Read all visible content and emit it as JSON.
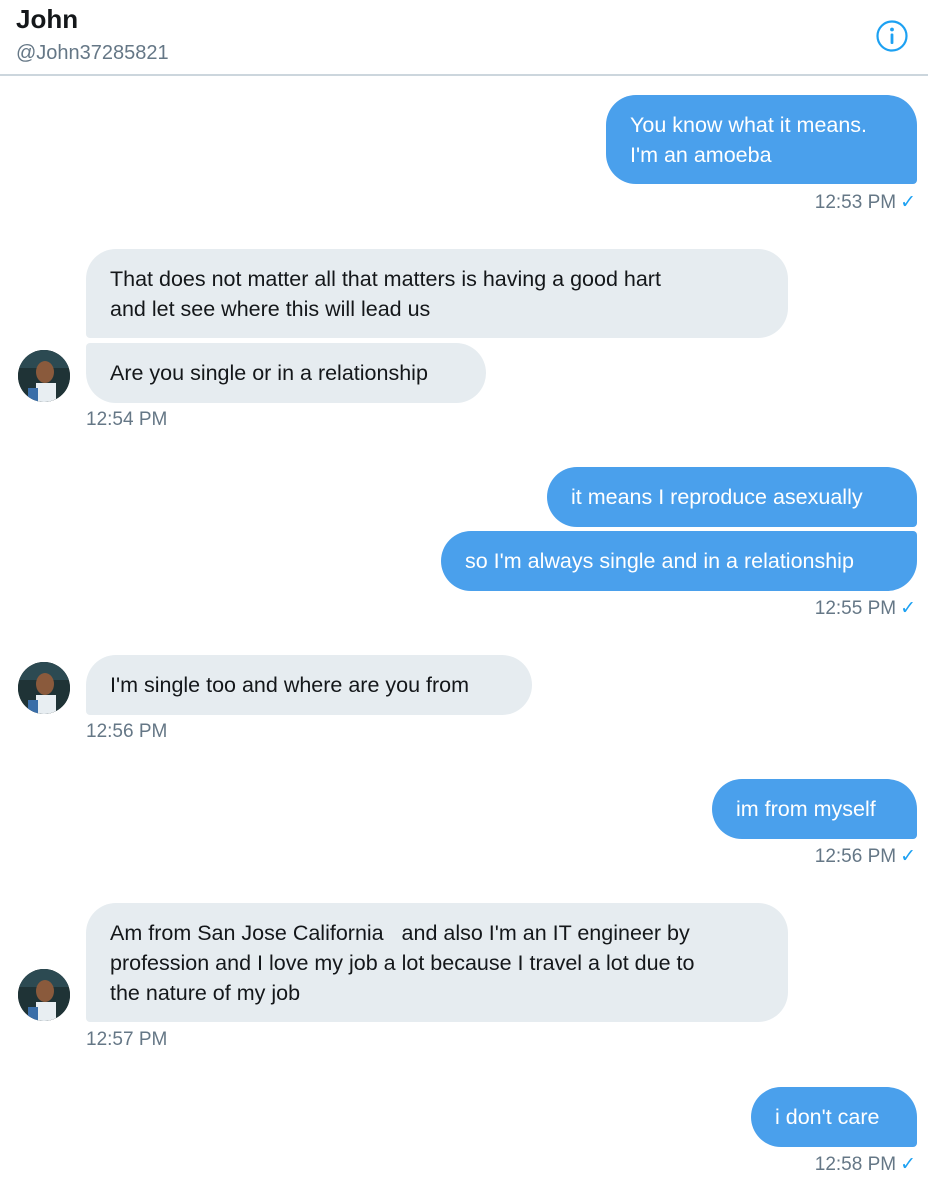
{
  "header": {
    "name": "John",
    "handle": "@John37285821",
    "info_icon": "info-circle-icon"
  },
  "colors": {
    "accent": "#1da1f2",
    "outgoing_bubble": "#4aa0ec",
    "incoming_bubble": "#e6ecf0",
    "meta_text": "#657786"
  },
  "messages": [
    {
      "from": "me",
      "lines": [
        "You know what it means.",
        "I'm an amoeba"
      ],
      "time": "12:53 PM",
      "check": "✓"
    },
    {
      "from": "John",
      "lines": [
        "That does not matter all that matters is having a good hart",
        "and let see where this will lead us"
      ]
    },
    {
      "from": "John",
      "lines": [
        "Are you single or in a relationship"
      ],
      "time": "12:54 PM"
    },
    {
      "from": "me",
      "lines": [
        "it means I reproduce asexually"
      ]
    },
    {
      "from": "me",
      "lines": [
        "so I'm always single and in a relationship"
      ],
      "time": "12:55 PM",
      "check": "✓"
    },
    {
      "from": "John",
      "lines": [
        "I'm single too and where are you from"
      ],
      "time": "12:56 PM"
    },
    {
      "from": "me",
      "lines": [
        "im from myself"
      ],
      "time": "12:56 PM",
      "check": "✓"
    },
    {
      "from": "John",
      "lines": [
        "Am from San Jose California   and also I'm an IT engineer by",
        "profession and I love my job a lot because I travel a lot due to",
        "the nature of my job"
      ],
      "time": "12:57 PM"
    },
    {
      "from": "me",
      "lines": [
        "i don't care"
      ],
      "time": "12:58 PM",
      "check": "✓"
    }
  ]
}
